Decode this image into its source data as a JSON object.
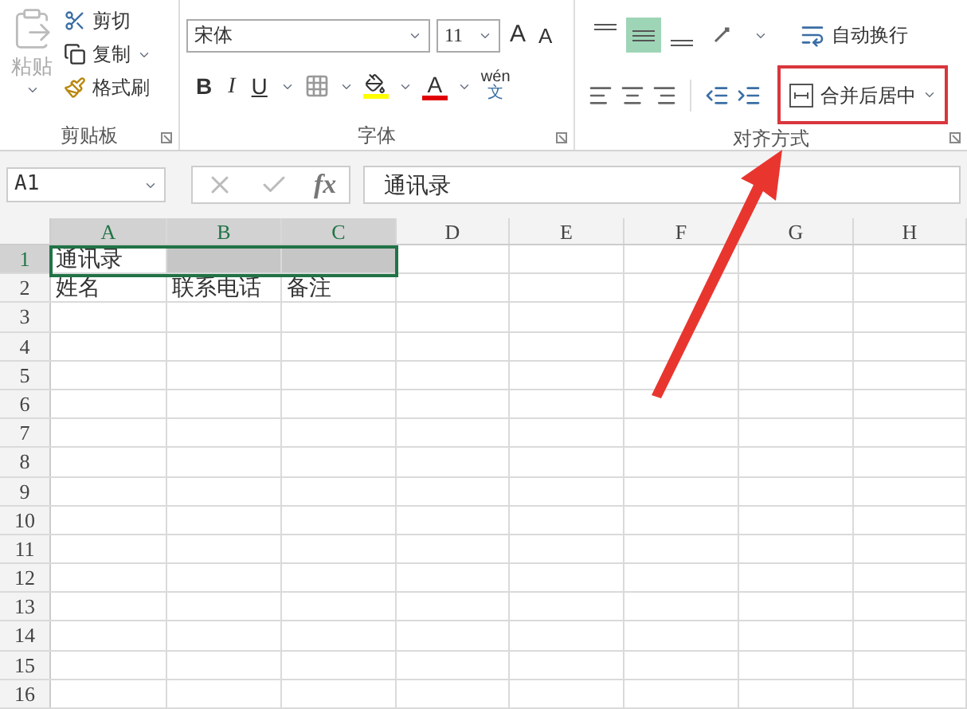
{
  "ribbon": {
    "clipboard": {
      "paste": "粘贴",
      "cut": "剪切",
      "copy": "复制",
      "format_painter": "格式刷",
      "label": "剪贴板"
    },
    "font": {
      "font_name": "宋体",
      "font_size": "11",
      "grow": "A",
      "shrink": "A",
      "bold": "B",
      "italic": "I",
      "underline": "U",
      "font_color": "A",
      "phonetic_top": "wén",
      "phonetic_bottom": "文",
      "label": "字体"
    },
    "alignment": {
      "vertical": [
        {
          "selected": false
        },
        {
          "selected": true
        },
        {
          "selected": false
        }
      ],
      "wrap_text": "自动换行",
      "merge_center": "合并后居中",
      "label": "对齐方式"
    }
  },
  "formula_bar": {
    "name_box": "A1",
    "fx": "fx",
    "formula": "通讯录"
  },
  "columns": [
    {
      "label": "A",
      "selected": true
    },
    {
      "label": "B",
      "selected": true
    },
    {
      "label": "C",
      "selected": true
    },
    {
      "label": "D",
      "selected": false
    },
    {
      "label": "E",
      "selected": false
    },
    {
      "label": "F",
      "selected": false
    },
    {
      "label": "G",
      "selected": false
    },
    {
      "label": "H",
      "selected": false
    }
  ],
  "rows": [
    {
      "label": "1",
      "selected": true,
      "cells": [
        "通讯录"
      ]
    },
    {
      "label": "2",
      "selected": false,
      "cells": [
        "姓名",
        "联系电话",
        "备注"
      ]
    },
    {
      "label": "3",
      "selected": false,
      "cells": []
    },
    {
      "label": "4",
      "selected": false,
      "cells": []
    },
    {
      "label": "5",
      "selected": false,
      "cells": []
    },
    {
      "label": "6",
      "selected": false,
      "cells": []
    },
    {
      "label": "7",
      "selected": false,
      "cells": []
    },
    {
      "label": "8",
      "selected": false,
      "cells": []
    },
    {
      "label": "9",
      "selected": false,
      "cells": []
    },
    {
      "label": "10",
      "selected": false,
      "cells": []
    },
    {
      "label": "11",
      "selected": false,
      "cells": []
    },
    {
      "label": "12",
      "selected": false,
      "cells": []
    },
    {
      "label": "13",
      "selected": false,
      "cells": []
    },
    {
      "label": "14",
      "selected": false,
      "cells": []
    },
    {
      "label": "15",
      "selected": false,
      "cells": []
    },
    {
      "label": "16",
      "selected": false,
      "cells": []
    }
  ],
  "annotation": {
    "highlight_merge_button": true
  }
}
